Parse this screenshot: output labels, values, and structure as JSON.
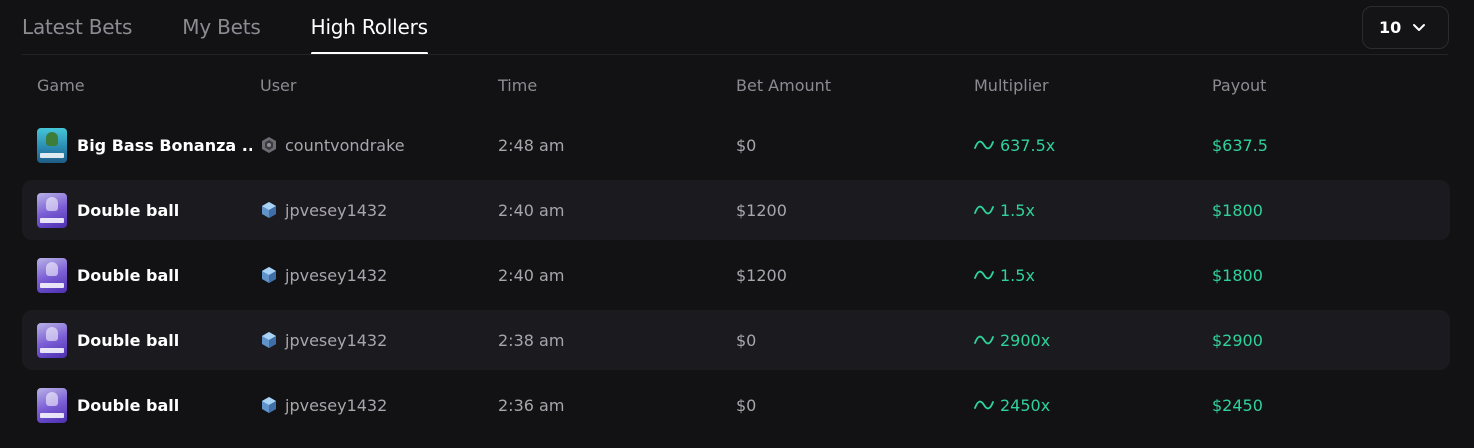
{
  "tabs": [
    {
      "label": "Latest Bets"
    },
    {
      "label": "My Bets"
    },
    {
      "label": "High Rollers"
    }
  ],
  "active_tab": "High Rollers",
  "count_select": {
    "value": "10",
    "icon": "chevron-down-icon"
  },
  "columns": {
    "game": "Game",
    "user": "User",
    "time": "Time",
    "bet": "Bet Amount",
    "multiplier": "Multiplier",
    "payout": "Payout"
  },
  "rows": [
    {
      "game": "Big Bass Bonanza ...",
      "thumb": "bass",
      "user": "countvondrake",
      "user_icon": "grey-shield-icon",
      "time": "2:48 am",
      "bet": "$0",
      "multiplier": "637.5x",
      "payout": "$637.5"
    },
    {
      "game": "Double ball",
      "thumb": "dball",
      "user": "jpvesey1432",
      "user_icon": "blue-gem-icon",
      "time": "2:40 am",
      "bet": "$1200",
      "multiplier": "1.5x",
      "payout": "$1800"
    },
    {
      "game": "Double ball",
      "thumb": "dball",
      "user": "jpvesey1432",
      "user_icon": "blue-gem-icon",
      "time": "2:40 am",
      "bet": "$1200",
      "multiplier": "1.5x",
      "payout": "$1800"
    },
    {
      "game": "Double ball",
      "thumb": "dball",
      "user": "jpvesey1432",
      "user_icon": "blue-gem-icon",
      "time": "2:38 am",
      "bet": "$0",
      "multiplier": "2900x",
      "payout": "$2900"
    },
    {
      "game": "Double ball",
      "thumb": "dball",
      "user": "jpvesey1432",
      "user_icon": "blue-gem-icon",
      "time": "2:36 am",
      "bet": "$0",
      "multiplier": "2450x",
      "payout": "$2450"
    }
  ],
  "colors": {
    "accent_green": "#2fd29a",
    "background": "#121114",
    "row_alt": "#1b1a1e"
  }
}
